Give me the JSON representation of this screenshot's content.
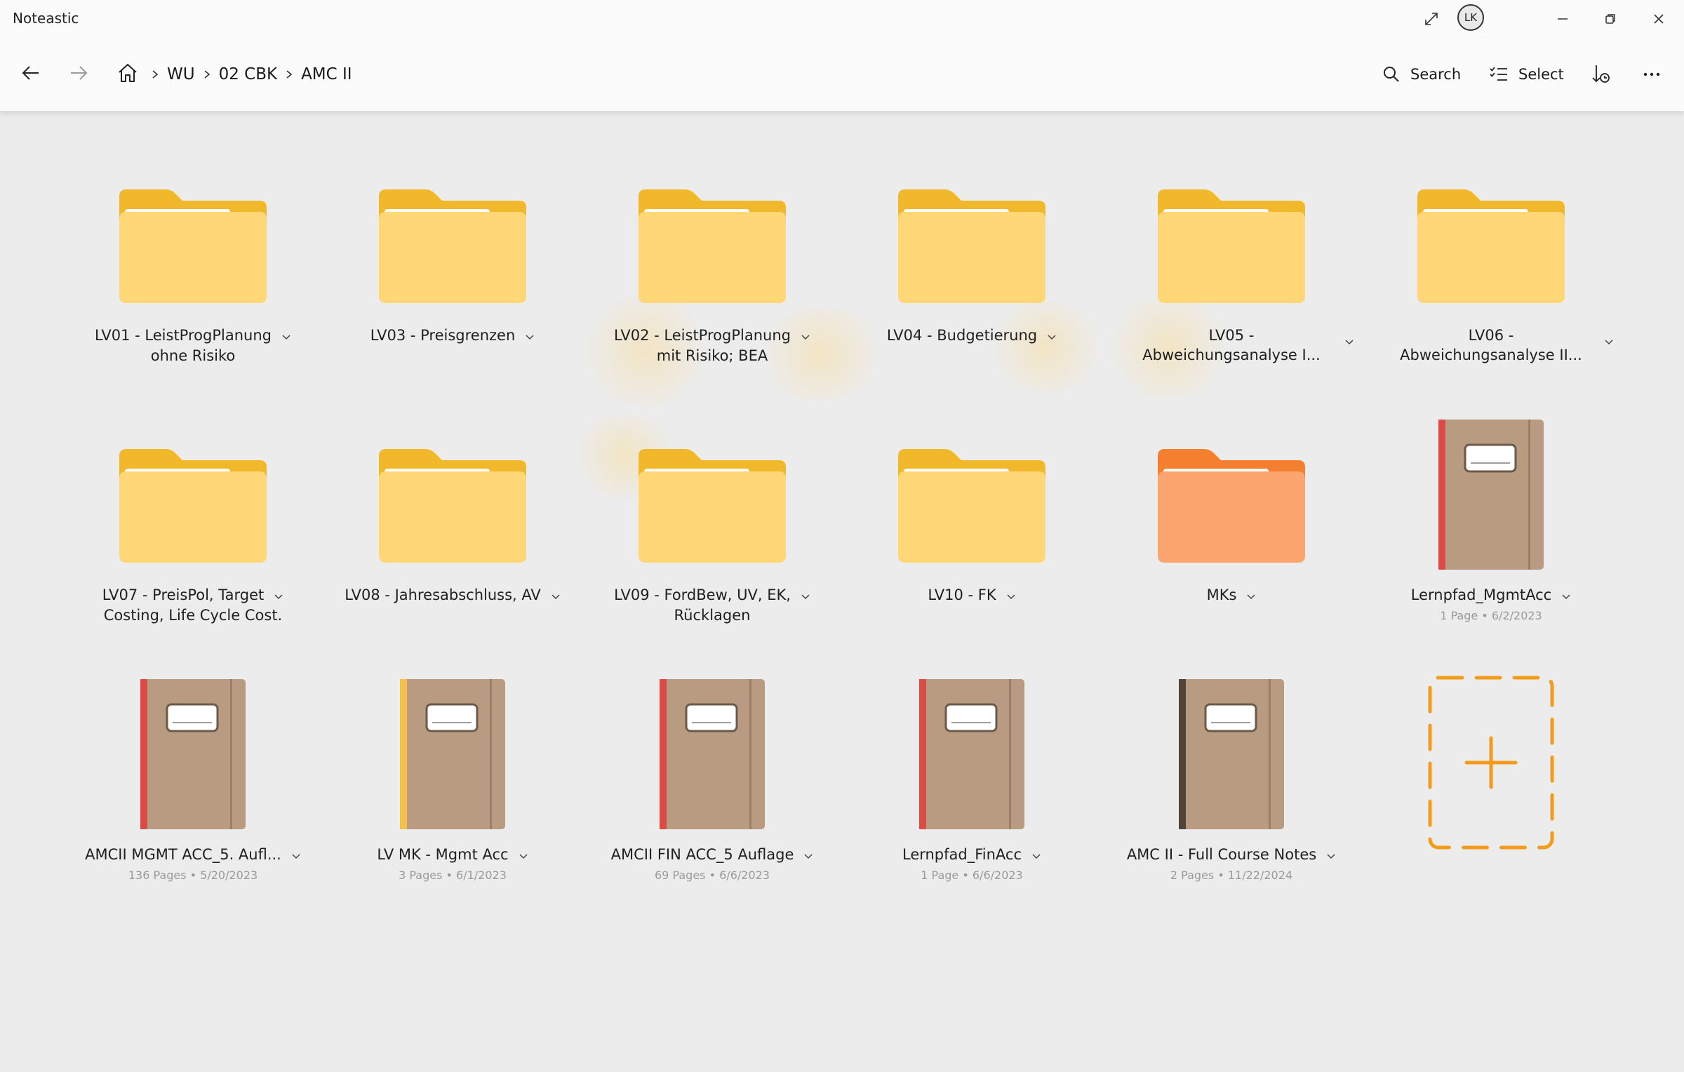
{
  "app": {
    "title": "Noteastic",
    "avatar_initials": "LK"
  },
  "breadcrumb": [
    "WU",
    "02 CBK",
    "AMC II"
  ],
  "toolbar": {
    "search_label": "Search",
    "select_label": "Select"
  },
  "colors": {
    "folder_yellow": "#ffd776",
    "folder_yellow_tab": "#f0b82a",
    "folder_orange": "#fca56e",
    "folder_orange_tab": "#f47f2e",
    "notebook_body": "#b89b80",
    "add_tile": "#f59b1c"
  },
  "folders": [
    {
      "line1": "LV01 - LeistProgPlanung",
      "line2": "ohne Risiko",
      "color": "yellow"
    },
    {
      "line1": "LV03 - Preisgrenzen",
      "line2": "",
      "color": "yellow"
    },
    {
      "line1": "LV02 - LeistProgPlanung",
      "line2": "mit Risiko; BEA",
      "color": "yellow"
    },
    {
      "line1": "LV04 - Budgetierung",
      "line2": "",
      "color": "yellow"
    },
    {
      "line1": "LV05 -",
      "line2": "Abweichungsanalyse I...",
      "color": "yellow"
    },
    {
      "line1": "LV06 -",
      "line2": "Abweichungsanalyse II...",
      "color": "yellow"
    },
    {
      "line1": "LV07 - PreisPol, Target",
      "line2": "Costing, Life Cycle Cost.",
      "color": "yellow"
    },
    {
      "line1": "LV08 - Jahresabschluss, AV",
      "line2": "",
      "color": "yellow"
    },
    {
      "line1": "LV09 - FordBew, UV, EK,",
      "line2": "Rücklagen",
      "color": "yellow"
    },
    {
      "line1": "LV10 - FK",
      "line2": "",
      "color": "yellow"
    },
    {
      "line1": "MKs",
      "line2": "",
      "color": "orange"
    }
  ],
  "notebooks": [
    {
      "title": "Lernpfad_MgmtAcc",
      "meta": "1 Page • 6/2/2023",
      "spine": "#dc4a45"
    },
    {
      "title": "AMCII MGMT ACC_5. Aufl...",
      "meta": "136 Pages • 5/20/2023",
      "spine": "#dc4a45"
    },
    {
      "title": "LV MK - Mgmt Acc",
      "meta": "3 Pages • 6/1/2023",
      "spine": "#f3c04a"
    },
    {
      "title": "AMCII FIN ACC_5 Auflage",
      "meta": "69 Pages • 6/6/2023",
      "spine": "#dc4a45"
    },
    {
      "title": "Lernpfad_FinAcc",
      "meta": "1 Page • 6/6/2023",
      "spine": "#dc4a45"
    },
    {
      "title": "AMC II - Full Course Notes",
      "meta": "2 Pages • 11/22/2024",
      "spine": "#4e4437"
    }
  ]
}
